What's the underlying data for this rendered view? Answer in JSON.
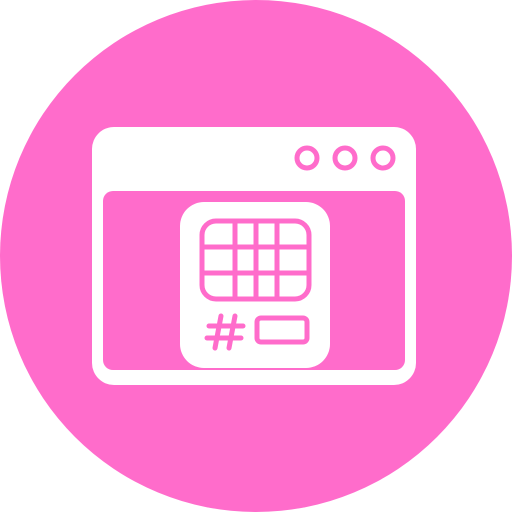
{
  "icon": {
    "name": "browser-window-with-chip-card-icon",
    "colors": {
      "background": "#ff6ccb",
      "foreground": "#ffffff"
    },
    "elements": {
      "window_controls": [
        "circle",
        "circle",
        "circle"
      ],
      "card_grid": {
        "rows": 3,
        "columns": 4
      },
      "card_symbol": "#"
    }
  }
}
